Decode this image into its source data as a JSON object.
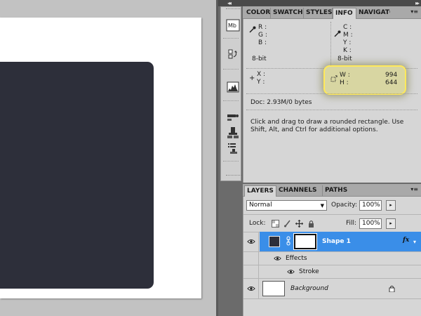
{
  "panel_tabs": [
    "COLOR",
    "SWATCHES",
    "STYLES",
    "INFO",
    "NAVIGATOR"
  ],
  "info": {
    "rgb_labels": [
      "R :",
      "G :",
      "B :"
    ],
    "cmyk_labels": [
      "C :",
      "M :",
      "Y :",
      "K :"
    ],
    "bitdepth_left": "8-bit",
    "bitdepth_right": "8-bit",
    "xy_labels": [
      "X :",
      "Y :"
    ],
    "w_label": "W :",
    "h_label": "H :",
    "w_value": "994",
    "h_value": "644",
    "doc": "Doc: 2.93M/0 bytes",
    "hint_line1": "Click and drag to draw a rounded rectangle.  Use",
    "hint_line2": "Shift, Alt, and Ctrl for additional options."
  },
  "layers_tabs": [
    "LAYERS",
    "CHANNELS",
    "PATHS"
  ],
  "layers": {
    "blend_mode": "Normal",
    "opacity_label": "Opacity:",
    "opacity": "100%",
    "lock_label": "Lock:",
    "fill_label": "Fill:",
    "fill": "100%",
    "rows": {
      "shape": "Shape 1",
      "fx": "fx",
      "effects": "Effects",
      "stroke": "Stroke",
      "background": "Background"
    }
  },
  "colors": {
    "shape_fill": "#2d2f3a",
    "selection": "#3a8ee8",
    "highlight_border": "#ffe95a"
  }
}
